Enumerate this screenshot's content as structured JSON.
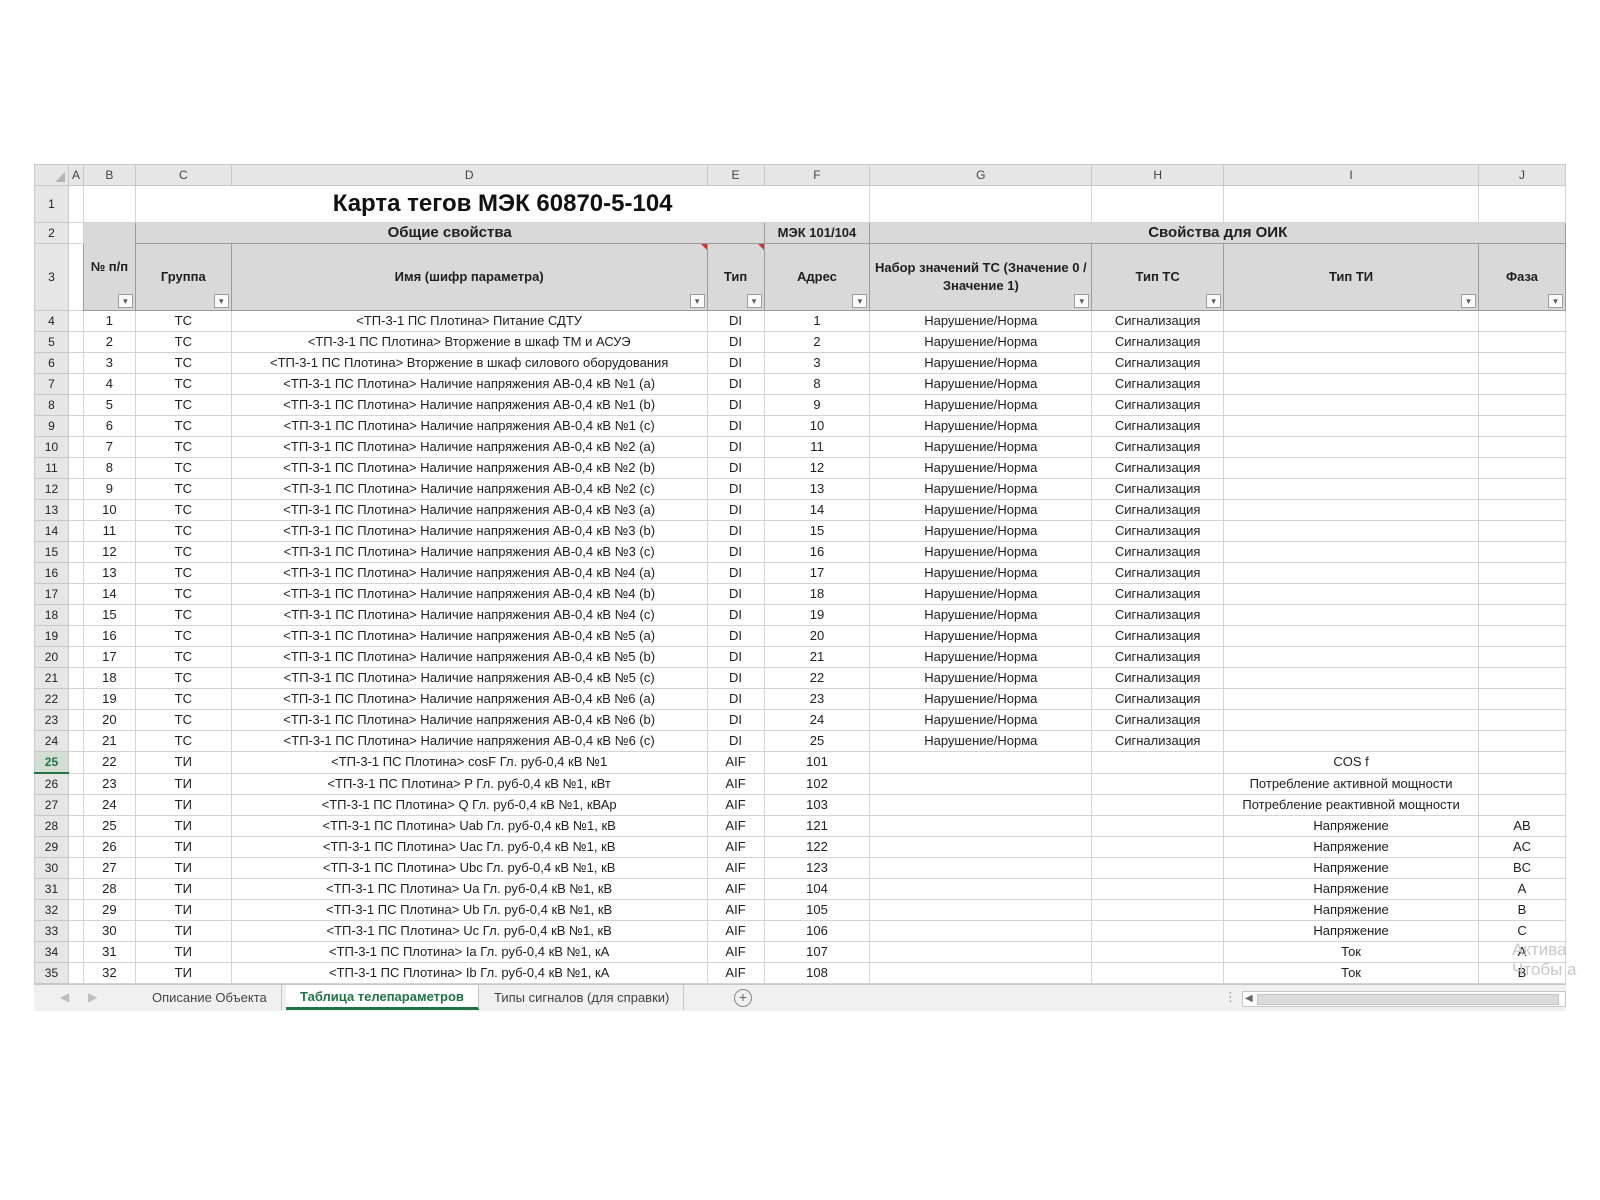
{
  "column_letters": [
    "A",
    "B",
    "C",
    "D",
    "E",
    "F",
    "G",
    "H",
    "I",
    "J"
  ],
  "title": "Карта тегов МЭК 60870-5-104",
  "bands": {
    "general": "Общие свойства",
    "iec": "МЭК 101/104",
    "oik": "Свойства для ОИК"
  },
  "headers": {
    "num": "№ п/п",
    "group": "Группа",
    "name": "Имя (шифр параметра)",
    "type": "Тип",
    "address": "Адрес",
    "ts_values": "Набор значений ТС (Значение 0 / Значение 1)",
    "ts_type": "Тип ТС",
    "ti_type": "Тип ТИ",
    "phase": "Фаза"
  },
  "filter_glyph": "▾",
  "row_numbers": [
    "1",
    "2",
    "3",
    "4",
    "5",
    "6",
    "7",
    "8",
    "9",
    "10",
    "11",
    "12",
    "13",
    "14",
    "15",
    "16",
    "17",
    "18",
    "19",
    "20",
    "21",
    "22",
    "23",
    "24",
    "25",
    "26",
    "27",
    "28",
    "29",
    "30",
    "31",
    "32",
    "33",
    "34",
    "35"
  ],
  "selected_row": "25",
  "rows": [
    {
      "n": "1",
      "g": "ТС",
      "name": "<ТП-3-1 ПС Плотина> Питание СДТУ",
      "t": "DI",
      "a": "1",
      "v": "Нарушение/Норма",
      "tt": "Сигнализация",
      "ti": "",
      "ph": ""
    },
    {
      "n": "2",
      "g": "ТС",
      "name": "<ТП-3-1 ПС Плотина> Вторжение в шкаф ТМ и АСУЭ",
      "t": "DI",
      "a": "2",
      "v": "Нарушение/Норма",
      "tt": "Сигнализация",
      "ti": "",
      "ph": ""
    },
    {
      "n": "3",
      "g": "ТС",
      "name": "<ТП-3-1 ПС Плотина> Вторжение в шкаф силового оборудования",
      "t": "DI",
      "a": "3",
      "v": "Нарушение/Норма",
      "tt": "Сигнализация",
      "ti": "",
      "ph": ""
    },
    {
      "n": "4",
      "g": "ТС",
      "name": "<ТП-3-1 ПС Плотина> Наличие напряжения АВ-0,4 кВ №1 (a)",
      "t": "DI",
      "a": "8",
      "v": "Нарушение/Норма",
      "tt": "Сигнализация",
      "ti": "",
      "ph": ""
    },
    {
      "n": "5",
      "g": "ТС",
      "name": "<ТП-3-1 ПС Плотина> Наличие напряжения АВ-0,4 кВ №1 (b)",
      "t": "DI",
      "a": "9",
      "v": "Нарушение/Норма",
      "tt": "Сигнализация",
      "ti": "",
      "ph": ""
    },
    {
      "n": "6",
      "g": "ТС",
      "name": "<ТП-3-1 ПС Плотина> Наличие напряжения АВ-0,4 кВ №1 (c)",
      "t": "DI",
      "a": "10",
      "v": "Нарушение/Норма",
      "tt": "Сигнализация",
      "ti": "",
      "ph": ""
    },
    {
      "n": "7",
      "g": "ТС",
      "name": "<ТП-3-1 ПС Плотина> Наличие напряжения АВ-0,4 кВ №2 (a)",
      "t": "DI",
      "a": "11",
      "v": "Нарушение/Норма",
      "tt": "Сигнализация",
      "ti": "",
      "ph": ""
    },
    {
      "n": "8",
      "g": "ТС",
      "name": "<ТП-3-1 ПС Плотина> Наличие напряжения АВ-0,4 кВ №2 (b)",
      "t": "DI",
      "a": "12",
      "v": "Нарушение/Норма",
      "tt": "Сигнализация",
      "ti": "",
      "ph": ""
    },
    {
      "n": "9",
      "g": "ТС",
      "name": "<ТП-3-1 ПС Плотина> Наличие напряжения АВ-0,4 кВ №2 (c)",
      "t": "DI",
      "a": "13",
      "v": "Нарушение/Норма",
      "tt": "Сигнализация",
      "ti": "",
      "ph": ""
    },
    {
      "n": "10",
      "g": "ТС",
      "name": "<ТП-3-1 ПС Плотина> Наличие напряжения АВ-0,4 кВ №3 (a)",
      "t": "DI",
      "a": "14",
      "v": "Нарушение/Норма",
      "tt": "Сигнализация",
      "ti": "",
      "ph": ""
    },
    {
      "n": "11",
      "g": "ТС",
      "name": "<ТП-3-1 ПС Плотина> Наличие напряжения АВ-0,4 кВ №3 (b)",
      "t": "DI",
      "a": "15",
      "v": "Нарушение/Норма",
      "tt": "Сигнализация",
      "ti": "",
      "ph": ""
    },
    {
      "n": "12",
      "g": "ТС",
      "name": "<ТП-3-1 ПС Плотина> Наличие напряжения АВ-0,4 кВ №3 (c)",
      "t": "DI",
      "a": "16",
      "v": "Нарушение/Норма",
      "tt": "Сигнализация",
      "ti": "",
      "ph": ""
    },
    {
      "n": "13",
      "g": "ТС",
      "name": "<ТП-3-1 ПС Плотина> Наличие напряжения АВ-0,4 кВ №4 (a)",
      "t": "DI",
      "a": "17",
      "v": "Нарушение/Норма",
      "tt": "Сигнализация",
      "ti": "",
      "ph": ""
    },
    {
      "n": "14",
      "g": "ТС",
      "name": "<ТП-3-1 ПС Плотина> Наличие напряжения АВ-0,4 кВ №4 (b)",
      "t": "DI",
      "a": "18",
      "v": "Нарушение/Норма",
      "tt": "Сигнализация",
      "ti": "",
      "ph": ""
    },
    {
      "n": "15",
      "g": "ТС",
      "name": "<ТП-3-1 ПС Плотина> Наличие напряжения АВ-0,4 кВ №4 (c)",
      "t": "DI",
      "a": "19",
      "v": "Нарушение/Норма",
      "tt": "Сигнализация",
      "ti": "",
      "ph": ""
    },
    {
      "n": "16",
      "g": "ТС",
      "name": "<ТП-3-1 ПС Плотина> Наличие напряжения АВ-0,4 кВ №5 (a)",
      "t": "DI",
      "a": "20",
      "v": "Нарушение/Норма",
      "tt": "Сигнализация",
      "ti": "",
      "ph": ""
    },
    {
      "n": "17",
      "g": "ТС",
      "name": "<ТП-3-1 ПС Плотина> Наличие напряжения АВ-0,4 кВ №5 (b)",
      "t": "DI",
      "a": "21",
      "v": "Нарушение/Норма",
      "tt": "Сигнализация",
      "ti": "",
      "ph": ""
    },
    {
      "n": "18",
      "g": "ТС",
      "name": "<ТП-3-1 ПС Плотина> Наличие напряжения АВ-0,4 кВ №5 (c)",
      "t": "DI",
      "a": "22",
      "v": "Нарушение/Норма",
      "tt": "Сигнализация",
      "ti": "",
      "ph": ""
    },
    {
      "n": "19",
      "g": "ТС",
      "name": "<ТП-3-1 ПС Плотина> Наличие напряжения АВ-0,4 кВ №6 (a)",
      "t": "DI",
      "a": "23",
      "v": "Нарушение/Норма",
      "tt": "Сигнализация",
      "ti": "",
      "ph": ""
    },
    {
      "n": "20",
      "g": "ТС",
      "name": "<ТП-3-1 ПС Плотина> Наличие напряжения АВ-0,4 кВ №6 (b)",
      "t": "DI",
      "a": "24",
      "v": "Нарушение/Норма",
      "tt": "Сигнализация",
      "ti": "",
      "ph": ""
    },
    {
      "n": "21",
      "g": "ТС",
      "name": "<ТП-3-1 ПС Плотина> Наличие напряжения АВ-0,4 кВ №6 (c)",
      "t": "DI",
      "a": "25",
      "v": "Нарушение/Норма",
      "tt": "Сигнализация",
      "ti": "",
      "ph": ""
    },
    {
      "n": "22",
      "g": "ТИ",
      "name": "<ТП-3-1 ПС Плотина> cosF Гл. руб-0,4 кВ №1",
      "t": "AIF",
      "a": "101",
      "v": "",
      "tt": "",
      "ti": "COS f",
      "ph": ""
    },
    {
      "n": "23",
      "g": "ТИ",
      "name": "<ТП-3-1 ПС Плотина> P Гл. руб-0,4 кВ №1, кВт",
      "t": "AIF",
      "a": "102",
      "v": "",
      "tt": "",
      "ti": "Потребление активной мощности",
      "ph": ""
    },
    {
      "n": "24",
      "g": "ТИ",
      "name": "<ТП-3-1 ПС Плотина> Q Гл. руб-0,4 кВ №1, кВАр",
      "t": "AIF",
      "a": "103",
      "v": "",
      "tt": "",
      "ti": "Потребление реактивной мощности",
      "ph": ""
    },
    {
      "n": "25",
      "g": "ТИ",
      "name": "<ТП-3-1 ПС Плотина> Uab Гл. руб-0,4 кВ №1, кВ",
      "t": "AIF",
      "a": "121",
      "v": "",
      "tt": "",
      "ti": "Напряжение",
      "ph": "AB"
    },
    {
      "n": "26",
      "g": "ТИ",
      "name": "<ТП-3-1 ПС Плотина> Uac Гл. руб-0,4 кВ №1, кВ",
      "t": "AIF",
      "a": "122",
      "v": "",
      "tt": "",
      "ti": "Напряжение",
      "ph": "AC"
    },
    {
      "n": "27",
      "g": "ТИ",
      "name": "<ТП-3-1 ПС Плотина> Ubc Гл. руб-0,4 кВ №1, кВ",
      "t": "AIF",
      "a": "123",
      "v": "",
      "tt": "",
      "ti": "Напряжение",
      "ph": "BC"
    },
    {
      "n": "28",
      "g": "ТИ",
      "name": "<ТП-3-1 ПС Плотина> Ua Гл. руб-0,4 кВ №1, кВ",
      "t": "AIF",
      "a": "104",
      "v": "",
      "tt": "",
      "ti": "Напряжение",
      "ph": "A"
    },
    {
      "n": "29",
      "g": "ТИ",
      "name": "<ТП-3-1 ПС Плотина> Ub Гл. руб-0,4 кВ №1, кВ",
      "t": "AIF",
      "a": "105",
      "v": "",
      "tt": "",
      "ti": "Напряжение",
      "ph": "B"
    },
    {
      "n": "30",
      "g": "ТИ",
      "name": "<ТП-3-1 ПС Плотина> Uc Гл. руб-0,4 кВ №1, кВ",
      "t": "AIF",
      "a": "106",
      "v": "",
      "tt": "",
      "ti": "Напряжение",
      "ph": "C"
    },
    {
      "n": "31",
      "g": "ТИ",
      "name": "<ТП-3-1 ПС Плотина> Ia Гл. руб-0,4 кВ №1, кА",
      "t": "AIF",
      "a": "107",
      "v": "",
      "tt": "",
      "ti": "Ток",
      "ph": "A"
    },
    {
      "n": "32",
      "g": "ТИ",
      "name": "<ТП-3-1 ПС Плотина> Ib Гл. руб-0,4 кВ №1, кА",
      "t": "AIF",
      "a": "108",
      "v": "",
      "tt": "",
      "ti": "Ток",
      "ph": "B"
    }
  ],
  "sheet_tabs": {
    "nav_prev": "◀",
    "nav_next": "▶",
    "tabs": [
      "Описание Объекта",
      "Таблица телепараметров",
      "Типы сигналов (для справки)"
    ],
    "active_index": 1,
    "add_glyph": "+",
    "dots": "⋮",
    "scroll_left": "◀"
  },
  "watermark": {
    "line1": "Актива",
    "line2": "Чтобы а"
  }
}
